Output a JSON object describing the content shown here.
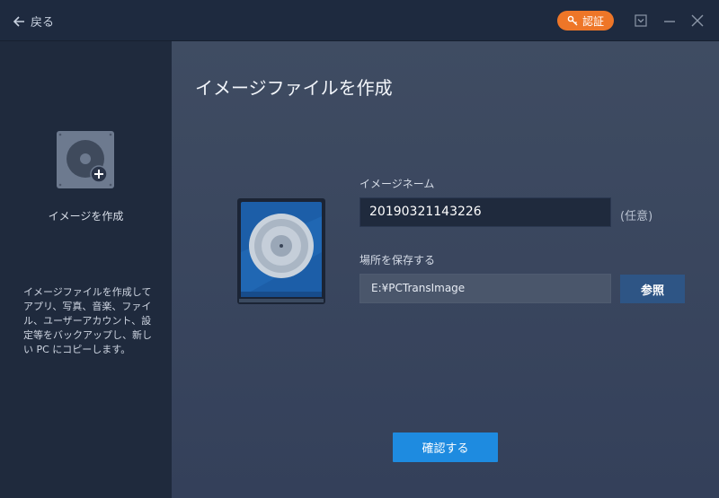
{
  "titlebar": {
    "back_label": "戻る",
    "auth_label": "認証"
  },
  "sidebar": {
    "label": "イメージを作成",
    "description": "イメージファイルを作成してアプリ、写真、音楽、ファイル、ユーザーアカウント、設定等をバックアップし、新しい PC にコピーします。"
  },
  "main": {
    "title": "イメージファイルを作成",
    "image_name_label": "イメージネーム",
    "image_name_value": "20190321143226",
    "optional_label": "(任意)",
    "save_location_label": "場所を保存する",
    "save_location_value": "E:¥PCTransImage",
    "browse_label": "参照",
    "confirm_label": "確認する"
  },
  "colors": {
    "accent": "#1e8be0",
    "auth": "#ee7628",
    "browse": "#2e5585"
  }
}
